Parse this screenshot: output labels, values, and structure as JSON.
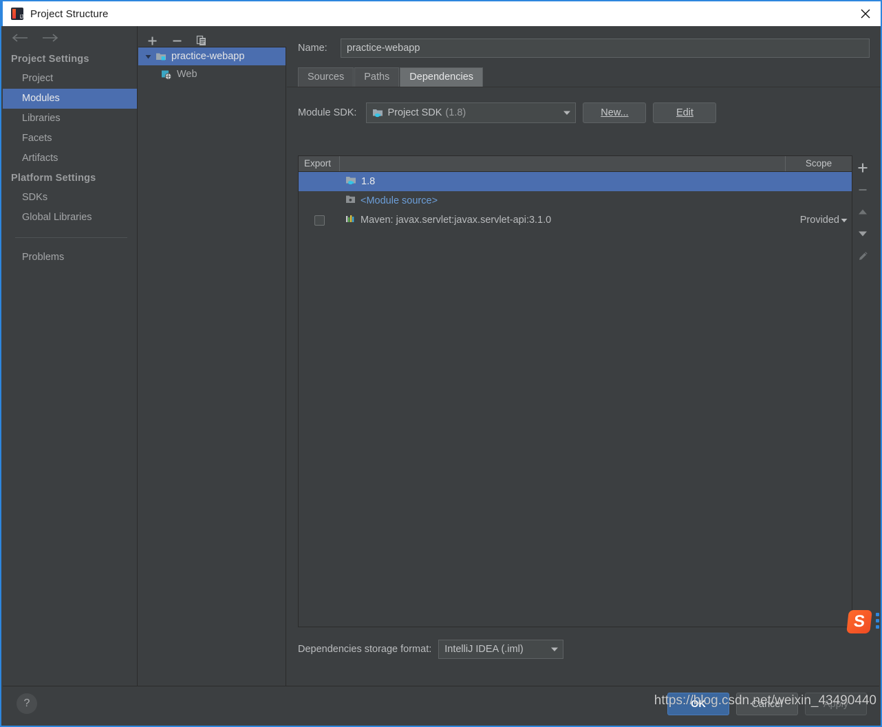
{
  "window": {
    "title": "Project Structure",
    "app_icon": "intellij-idea-icon",
    "close_icon": "close-icon"
  },
  "sidebar": {
    "nav": {
      "back_icon": "arrow-left-icon",
      "forward_icon": "arrow-right-icon"
    },
    "groups": [
      {
        "header": "Project Settings",
        "items": [
          {
            "label": "Project",
            "selected": false
          },
          {
            "label": "Modules",
            "selected": true
          },
          {
            "label": "Libraries",
            "selected": false
          },
          {
            "label": "Facets",
            "selected": false
          },
          {
            "label": "Artifacts",
            "selected": false
          }
        ]
      },
      {
        "header": "Platform Settings",
        "items": [
          {
            "label": "SDKs",
            "selected": false
          },
          {
            "label": "Global Libraries",
            "selected": false
          }
        ]
      }
    ],
    "problems": {
      "label": "Problems"
    }
  },
  "tree_panel": {
    "toolbar": [
      {
        "name": "add-module-button",
        "icon": "plus-icon"
      },
      {
        "name": "remove-module-button",
        "icon": "minus-icon"
      },
      {
        "name": "copy-module-button",
        "icon": "copy-icon"
      }
    ],
    "nodes": [
      {
        "label": "practice-webapp",
        "icon": "module-folder-icon",
        "expanded": true,
        "selected": true,
        "depth": 0
      },
      {
        "label": "Web",
        "icon": "web-facet-icon",
        "expanded": false,
        "selected": false,
        "depth": 1
      }
    ]
  },
  "main": {
    "name_label": "Name:",
    "name_value": "practice-webapp",
    "name_placeholder": "",
    "tabs": [
      {
        "label": "Sources",
        "active": false
      },
      {
        "label": "Paths",
        "active": false
      },
      {
        "label": "Dependencies",
        "active": true
      }
    ],
    "sdk": {
      "label": "Module SDK:",
      "value": "Project SDK",
      "value_suffix": "(1.8)",
      "icon": "jdk-icon",
      "dropdown_icon": "chevron-down-icon",
      "new_button": "New...",
      "new_button_mnemonic": "N",
      "edit_button": "Edit",
      "edit_button_mnemonic": "E"
    },
    "table": {
      "columns": [
        "Export",
        "",
        "Scope"
      ],
      "rows": [
        {
          "export_checkbox": null,
          "icon": "jdk-icon",
          "name": "1.8",
          "scope": "",
          "selected": true,
          "link": false
        },
        {
          "export_checkbox": null,
          "icon": "module-source-icon",
          "name": "<Module source>",
          "scope": "",
          "selected": false,
          "link": true
        },
        {
          "export_checkbox": false,
          "icon": "maven-library-icon",
          "name": "Maven: javax.servlet:javax.servlet-api:3.1.0",
          "scope": "Provided",
          "scope_dropdown_icon": "caret-down-icon",
          "selected": false,
          "link": false
        }
      ]
    },
    "side_toolbar": [
      {
        "name": "add-dependency-button",
        "icon": "plus-icon"
      },
      {
        "name": "remove-dependency-button",
        "icon": "minus-icon"
      },
      {
        "name": "move-up-button",
        "icon": "arrow-up-icon"
      },
      {
        "name": "move-down-button",
        "icon": "arrow-down-icon"
      },
      {
        "name": "edit-dependency-button",
        "icon": "pencil-icon"
      }
    ],
    "storage": {
      "label": "Dependencies storage format:",
      "value": "IntelliJ IDEA (.iml)",
      "dropdown_icon": "chevron-down-icon"
    }
  },
  "footer": {
    "help_label": "?",
    "buttons": [
      {
        "label": "OK",
        "style": "primary",
        "enabled": true
      },
      {
        "label": "Cancel",
        "style": "normal",
        "enabled": true
      },
      {
        "label": "Apply",
        "style": "disabled",
        "enabled": false
      }
    ]
  },
  "overlay": {
    "watermark_text": "https://blog.csdn.net/weixin_43490440",
    "ime_icon": "sogou-input-method-icon",
    "ime_letter": "S"
  }
}
